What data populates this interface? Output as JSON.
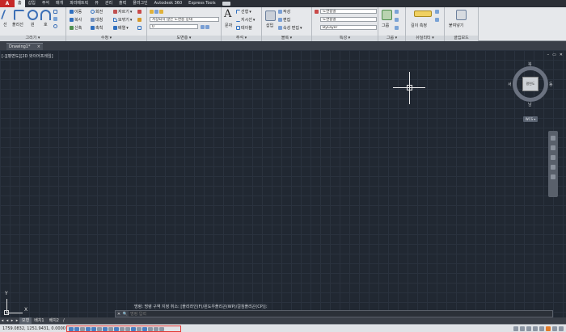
{
  "menubar": {
    "app_button": "A",
    "tabs": [
      "홈",
      "삽입",
      "주석",
      "매개",
      "파라메트릭",
      "뷰",
      "관리",
      "출력",
      "플러그인",
      "Autodesk 360",
      "Express Tools"
    ]
  },
  "ribbon": {
    "draw": {
      "title": "그리기 ▾",
      "line": "선",
      "polyline": "폴리선",
      "circle": "원",
      "arc": "호"
    },
    "modify": {
      "title": "수정 ▾",
      "move": "이동",
      "rotate": "회전",
      "trim": "자르기",
      "copy": "복사",
      "mirror": "대칭",
      "fillet": "모깎기",
      "stretch": "신축",
      "scale": "축척",
      "array": "배열"
    },
    "layers": {
      "title": "도면층 ▾",
      "layer_properties": "도면층 특성",
      "current_layer": "저장되지 않은 도면층 상태",
      "layer_value": "0"
    },
    "annotation": {
      "title": "주석 ▾",
      "text": "문자",
      "linear": "선형",
      "leader": "지시선",
      "table": "테이블"
    },
    "block": {
      "title": "블록 ▾",
      "insert": "삽입",
      "create": "작성",
      "edit": "편집",
      "edit_attributes": "속성 편집"
    },
    "properties": {
      "title": "특성 ▾",
      "color": "도면층별",
      "linetype": "도면층별",
      "lineweight": "ByLayer"
    },
    "groups": {
      "title": "그룹 ▾",
      "group": "그룹"
    },
    "utilities": {
      "title": "유틸리티 ▾",
      "measure": "길이 측정"
    },
    "clipboard": {
      "title": "클립보드",
      "paste": "붙여넣기"
    }
  },
  "doc_tab": {
    "name": "Drawing1*",
    "close": "×"
  },
  "canvas": {
    "viewport_label": "[-][평면도][2D 와이어프레임]",
    "win_min": "–",
    "win_restore": "▭",
    "win_close": "✕"
  },
  "viewcube": {
    "face": "평면도",
    "north": "북",
    "south": "남",
    "west": "서",
    "east": "동",
    "wcs": "WCS ▾"
  },
  "ucs": {
    "x_label": "X",
    "y_label": "Y"
  },
  "command": {
    "history": "명령: 명령 구역 지정 취소: [폴리라인(F)/윈도우폴리곤(WP)/걸침폴리곤(CP)]:",
    "close": "✕",
    "search": "🔍",
    "placeholder": "명령 입력"
  },
  "layout_tabs": {
    "tabs": [
      "모형",
      "배치1",
      "배치2"
    ],
    "add": "/"
  },
  "status": {
    "coords": "1759.0832, 1251.9431, 0.0000"
  }
}
